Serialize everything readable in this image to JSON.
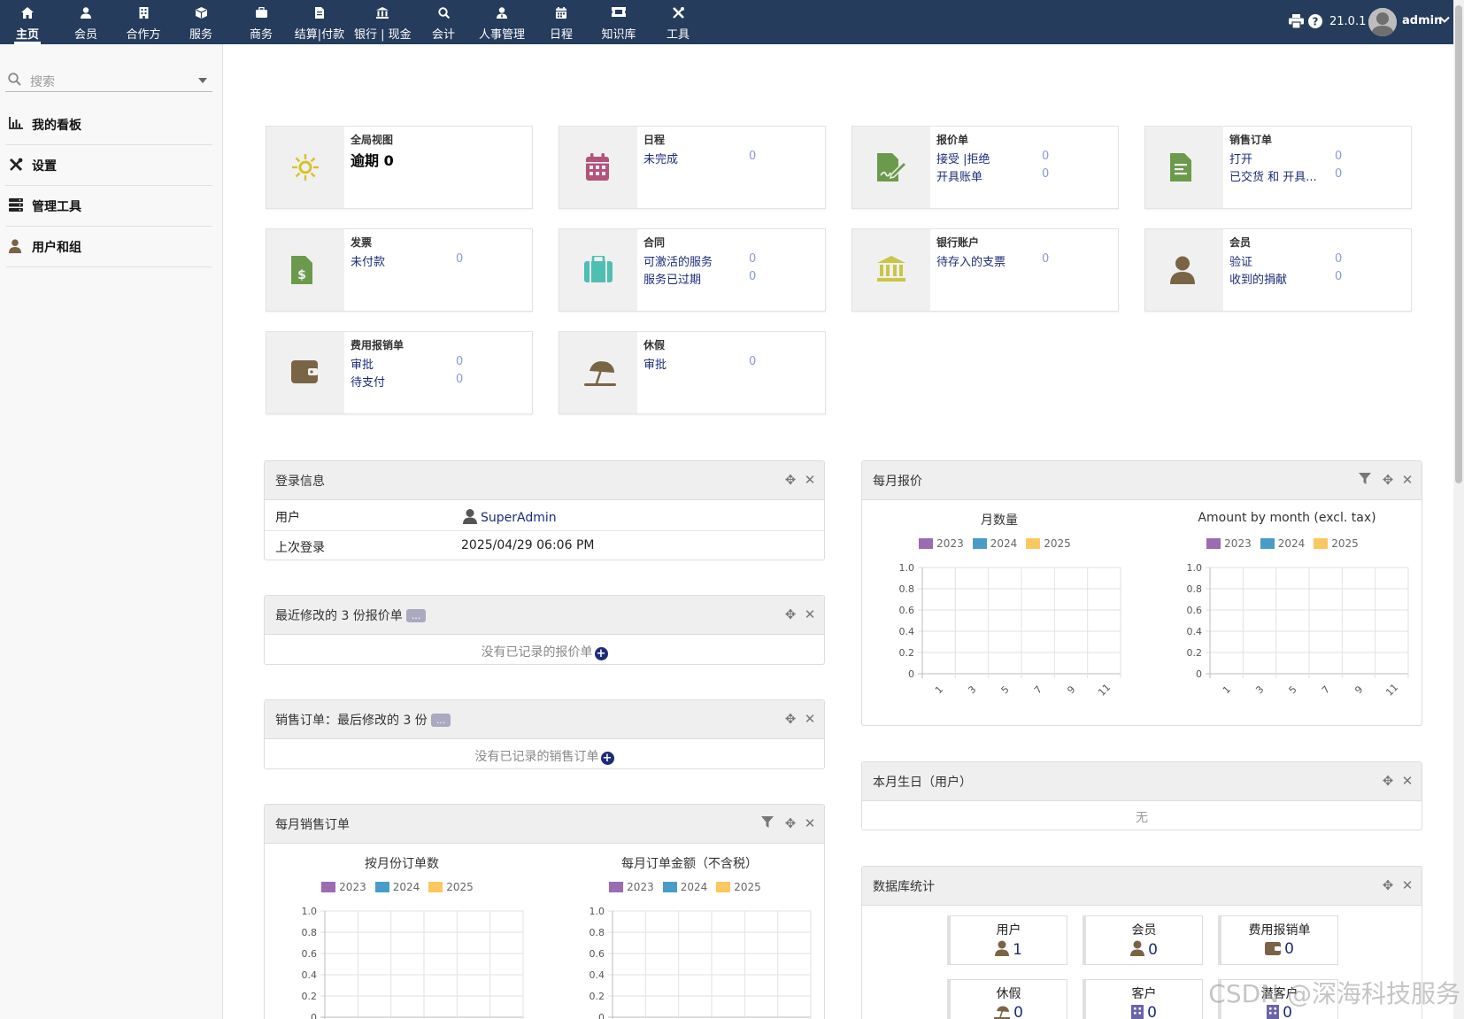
{
  "colors": {
    "topbar": "#263c5c",
    "link": "#1c2c7a",
    "series_2023": "#9b6bb3",
    "series_2024": "#4a9cc8",
    "series_2025": "#fbc85f"
  },
  "topbar": {
    "menu": [
      {
        "label": "主页",
        "icon": "home-icon"
      },
      {
        "label": "会员",
        "icon": "user-icon"
      },
      {
        "label": "合作方",
        "icon": "building-icon"
      },
      {
        "label": "服务",
        "icon": "cube-icon"
      },
      {
        "label": "商务",
        "icon": "briefcase-icon"
      },
      {
        "label": "结算|付款",
        "icon": "invoice-icon"
      },
      {
        "label": "银行 | 现金",
        "icon": "bank-icon"
      },
      {
        "label": "会计",
        "icon": "search-dollar-icon"
      },
      {
        "label": "人事管理",
        "icon": "user-tie-icon"
      },
      {
        "label": "日程",
        "icon": "calendar-icon"
      },
      {
        "label": "知识库",
        "icon": "ticket-icon"
      },
      {
        "label": "工具",
        "icon": "tools-icon"
      }
    ],
    "version": "21.0.1",
    "username": "admin"
  },
  "sidebar": {
    "search_placeholder": "搜索",
    "items": [
      {
        "label": "我的看板",
        "icon": "chart-bar-icon"
      },
      {
        "label": "设置",
        "icon": "tools-icon"
      },
      {
        "label": "管理工具",
        "icon": "server-icon"
      },
      {
        "label": "用户和组",
        "icon": "user-icon"
      }
    ]
  },
  "cards": {
    "global": {
      "title": "全局视图",
      "text": "逾期 0"
    },
    "agenda": {
      "title": "日程",
      "rows": [
        {
          "label": "未完成",
          "value": "0"
        }
      ]
    },
    "proposal": {
      "title": "报价单",
      "rows": [
        {
          "label": "接受 |拒绝",
          "value": "0"
        },
        {
          "label": "开具账单",
          "value": "0"
        }
      ]
    },
    "order": {
      "title": "销售订单",
      "rows": [
        {
          "label": "打开",
          "value": "0"
        },
        {
          "label": "已交货 和 开具...",
          "value": "0"
        }
      ]
    },
    "invoice": {
      "title": "发票",
      "rows": [
        {
          "label": "未付款",
          "value": "0"
        }
      ]
    },
    "contract": {
      "title": "合同",
      "rows": [
        {
          "label": "可激活的服务",
          "value": "0"
        },
        {
          "label": "服务已过期",
          "value": "0"
        }
      ]
    },
    "bank": {
      "title": "银行账户",
      "rows": [
        {
          "label": "待存入的支票",
          "value": "0"
        }
      ]
    },
    "member": {
      "title": "会员",
      "rows": [
        {
          "label": "验证",
          "value": "0"
        },
        {
          "label": "收到的捐献",
          "value": "0"
        }
      ]
    },
    "expense": {
      "title": "费用报销单",
      "rows": [
        {
          "label": "审批",
          "value": "0"
        },
        {
          "label": "待支付",
          "value": "0"
        }
      ]
    },
    "holiday": {
      "title": "休假",
      "rows": [
        {
          "label": "审批",
          "value": "0"
        }
      ]
    }
  },
  "login_panel": {
    "title": "登录信息",
    "user_label": "用户",
    "user_value": "SuperAdmin",
    "last_label": "上次登录",
    "last_value": "2025/04/29 06:06 PM"
  },
  "proposals_panel": {
    "title": "最近修改的 3 份报价单",
    "more": "...",
    "empty": "没有已记录的报价单"
  },
  "orders_panel": {
    "title": "销售订单：最后修改的 3 份",
    "more": "...",
    "empty": "没有已记录的销售订单"
  },
  "monthly_orders_panel": {
    "title": "每月销售订单"
  },
  "monthly_proposals_panel": {
    "title": "每月报价"
  },
  "birthday_panel": {
    "title": "本月生日（用户）",
    "empty": "无"
  },
  "dbstats_panel": {
    "title": "数据库统计",
    "items": [
      {
        "label": "用户",
        "value": "1",
        "icon": "user-icon"
      },
      {
        "label": "会员",
        "value": "0",
        "icon": "user-icon"
      },
      {
        "label": "费用报销单",
        "value": "0",
        "icon": "wallet-icon"
      },
      {
        "label": "休假",
        "value": "0",
        "icon": "umbrella-beach-icon"
      },
      {
        "label": "客户",
        "value": "0",
        "icon": "building-icon"
      },
      {
        "label": "潜客户",
        "value": "0",
        "icon": "building-icon"
      }
    ]
  },
  "chart_data": [
    {
      "type": "bar",
      "title": "月数量",
      "legend": [
        "2023",
        "2024",
        "2025"
      ],
      "x_ticks": [
        "1",
        "3",
        "5",
        "7",
        "9",
        "11"
      ],
      "y_ticks": [
        "0",
        "0.2",
        "0.4",
        "0.6",
        "0.8",
        "1.0"
      ],
      "ylim": [
        0,
        1.0
      ],
      "series": [
        {
          "name": "2023",
          "values": []
        },
        {
          "name": "2024",
          "values": []
        },
        {
          "name": "2025",
          "values": []
        }
      ],
      "grid": true,
      "legend_position": "top"
    },
    {
      "type": "bar",
      "title": "Amount by month (excl. tax)",
      "legend": [
        "2023",
        "2024",
        "2025"
      ],
      "x_ticks": [
        "1",
        "3",
        "5",
        "7",
        "9",
        "11"
      ],
      "y_ticks": [
        "0",
        "0.2",
        "0.4",
        "0.6",
        "0.8",
        "1.0"
      ],
      "ylim": [
        0,
        1.0
      ],
      "series": [
        {
          "name": "2023",
          "values": []
        },
        {
          "name": "2024",
          "values": []
        },
        {
          "name": "2025",
          "values": []
        }
      ],
      "grid": true,
      "legend_position": "top"
    },
    {
      "type": "bar",
      "title": "按月份订单数",
      "legend": [
        "2023",
        "2024",
        "2025"
      ],
      "y_ticks": [
        "0",
        "0.2",
        "0.4",
        "0.6",
        "0.8",
        "1.0"
      ],
      "ylim": [
        0,
        1.0
      ],
      "series": [
        {
          "name": "2023",
          "values": []
        },
        {
          "name": "2024",
          "values": []
        },
        {
          "name": "2025",
          "values": []
        }
      ],
      "grid": true,
      "legend_position": "top"
    },
    {
      "type": "bar",
      "title": "每月订单金额（不含税）",
      "legend": [
        "2023",
        "2024",
        "2025"
      ],
      "y_ticks": [
        "0",
        "0.2",
        "0.4",
        "0.6",
        "0.8",
        "1.0"
      ],
      "ylim": [
        0,
        1.0
      ],
      "series": [
        {
          "name": "2023",
          "values": []
        },
        {
          "name": "2024",
          "values": []
        },
        {
          "name": "2025",
          "values": []
        }
      ],
      "grid": true,
      "legend_position": "top"
    }
  ],
  "watermark": "CSDN @深海科技服务"
}
